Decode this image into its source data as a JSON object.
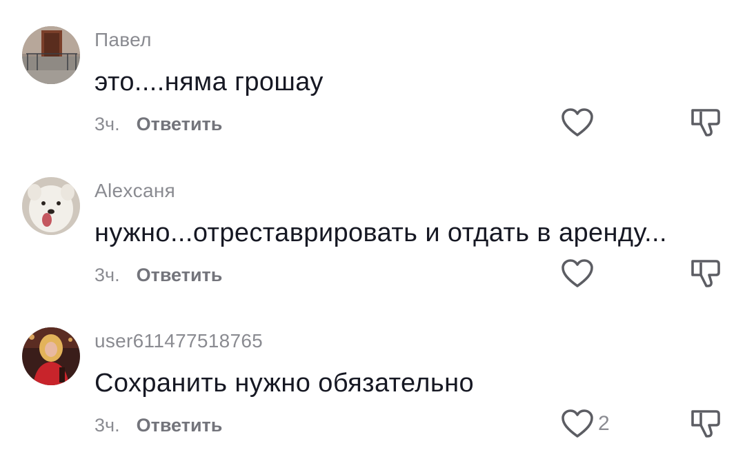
{
  "comments": [
    {
      "username": "Павел",
      "text": "это....няма грошау",
      "time": "3ч.",
      "reply_label": "Ответить",
      "like_count": "",
      "avatar": "house-porch-avatar"
    },
    {
      "username": "Alexсаня",
      "text": "нужно...отреставрировать и отдать в аренду...",
      "time": "3ч.",
      "reply_label": "Ответить",
      "like_count": "",
      "avatar": "white-dog-avatar"
    },
    {
      "username": "user611477518765",
      "text": "Сохранить нужно обязательно",
      "time": "3ч.",
      "reply_label": "Ответить",
      "like_count": "2",
      "avatar": "woman-red-dress-avatar"
    }
  ],
  "icons": {
    "like": "heart-outline-icon",
    "dislike": "thumbs-down-outline-icon"
  },
  "colors": {
    "text_primary": "#161823",
    "text_secondary": "#8a8b91",
    "icon": "#5c5d63"
  }
}
